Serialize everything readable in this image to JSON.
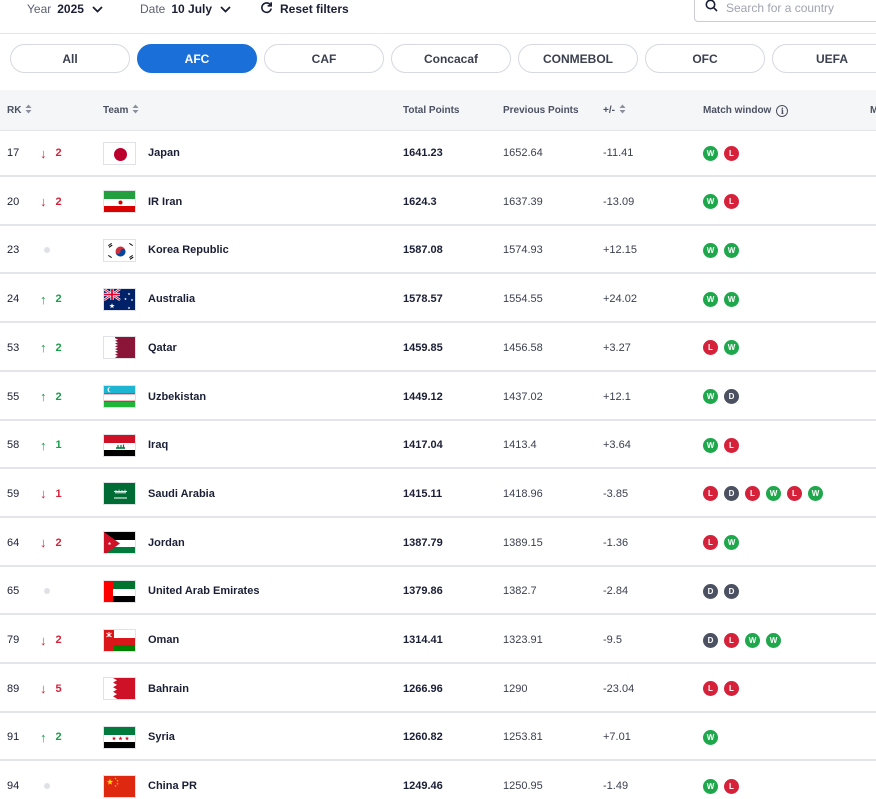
{
  "filters": {
    "year": {
      "label": "Year",
      "value": "2025"
    },
    "date": {
      "label": "Date",
      "value": "10 July"
    },
    "reset_label": "Reset filters",
    "search_placeholder": "Search for a country"
  },
  "confederations": [
    {
      "label": "All",
      "active": false
    },
    {
      "label": "AFC",
      "active": true
    },
    {
      "label": "CAF",
      "active": false
    },
    {
      "label": "Concacaf",
      "active": false
    },
    {
      "label": "CONMEBOL",
      "active": false
    },
    {
      "label": "OFC",
      "active": false
    },
    {
      "label": "UEFA",
      "active": false
    }
  ],
  "columns": {
    "rank": "RK",
    "team": "Team",
    "total": "Total Points",
    "previous": "Previous Points",
    "diff": "+/-",
    "window": "Match window",
    "extra": "M"
  },
  "colors": {
    "accent": "#1a6fd8",
    "up": "#1a9e4a",
    "down": "#d6213a",
    "win": "#1ea84b",
    "loss": "#d6213a",
    "draw": "#4b5161"
  },
  "rows": [
    {
      "rank": "17",
      "dir": "down",
      "move": "2",
      "flag": "japan",
      "team": "Japan",
      "total": "1641.23",
      "previous": "1652.64",
      "diff": "-11.41",
      "results": [
        "W",
        "L"
      ]
    },
    {
      "rank": "20",
      "dir": "down",
      "move": "2",
      "flag": "iran",
      "team": "IR Iran",
      "total": "1624.3",
      "previous": "1637.39",
      "diff": "-13.09",
      "results": [
        "W",
        "L"
      ]
    },
    {
      "rank": "23",
      "dir": "same",
      "move": "",
      "flag": "korea",
      "team": "Korea Republic",
      "total": "1587.08",
      "previous": "1574.93",
      "diff": "+12.15",
      "results": [
        "W",
        "W"
      ]
    },
    {
      "rank": "24",
      "dir": "up",
      "move": "2",
      "flag": "australia",
      "team": "Australia",
      "total": "1578.57",
      "previous": "1554.55",
      "diff": "+24.02",
      "results": [
        "W",
        "W"
      ]
    },
    {
      "rank": "53",
      "dir": "up",
      "move": "2",
      "flag": "qatar",
      "team": "Qatar",
      "total": "1459.85",
      "previous": "1456.58",
      "diff": "+3.27",
      "results": [
        "L",
        "W"
      ]
    },
    {
      "rank": "55",
      "dir": "up",
      "move": "2",
      "flag": "uzbekistan",
      "team": "Uzbekistan",
      "total": "1449.12",
      "previous": "1437.02",
      "diff": "+12.1",
      "results": [
        "W",
        "D"
      ]
    },
    {
      "rank": "58",
      "dir": "up",
      "move": "1",
      "flag": "iraq",
      "team": "Iraq",
      "total": "1417.04",
      "previous": "1413.4",
      "diff": "+3.64",
      "results": [
        "W",
        "L"
      ]
    },
    {
      "rank": "59",
      "dir": "down",
      "move": "1",
      "flag": "saudi",
      "team": "Saudi Arabia",
      "total": "1415.11",
      "previous": "1418.96",
      "diff": "-3.85",
      "results": [
        "L",
        "D",
        "L",
        "W",
        "L",
        "W"
      ]
    },
    {
      "rank": "64",
      "dir": "down",
      "move": "2",
      "flag": "jordan",
      "team": "Jordan",
      "total": "1387.79",
      "previous": "1389.15",
      "diff": "-1.36",
      "results": [
        "L",
        "W"
      ]
    },
    {
      "rank": "65",
      "dir": "same",
      "move": "",
      "flag": "uae",
      "team": "United Arab Emirates",
      "total": "1379.86",
      "previous": "1382.7",
      "diff": "-2.84",
      "results": [
        "D",
        "D"
      ]
    },
    {
      "rank": "79",
      "dir": "down",
      "move": "2",
      "flag": "oman",
      "team": "Oman",
      "total": "1314.41",
      "previous": "1323.91",
      "diff": "-9.5",
      "results": [
        "D",
        "L",
        "W",
        "W"
      ]
    },
    {
      "rank": "89",
      "dir": "down",
      "move": "5",
      "flag": "bahrain",
      "team": "Bahrain",
      "total": "1266.96",
      "previous": "1290",
      "diff": "-23.04",
      "results": [
        "L",
        "L"
      ]
    },
    {
      "rank": "91",
      "dir": "up",
      "move": "2",
      "flag": "syria",
      "team": "Syria",
      "total": "1260.82",
      "previous": "1253.81",
      "diff": "+7.01",
      "results": [
        "W"
      ]
    },
    {
      "rank": "94",
      "dir": "same",
      "move": "",
      "flag": "china",
      "team": "China PR",
      "total": "1249.46",
      "previous": "1250.95",
      "diff": "-1.49",
      "results": [
        "W",
        "L"
      ]
    }
  ]
}
